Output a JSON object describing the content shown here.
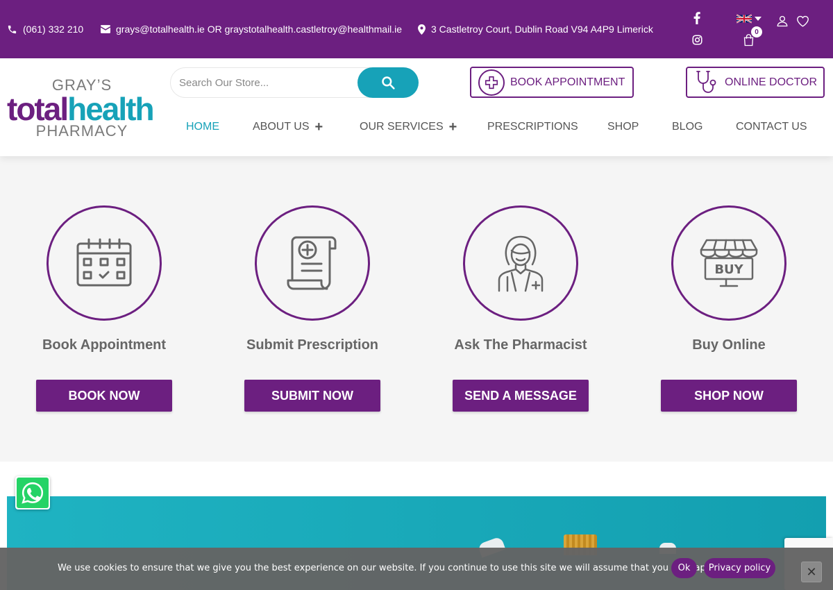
{
  "topbar": {
    "phone": "(061) 332 210",
    "email": "grays@totalhealth.ie OR graystotalhealth.castletroy@healthmail.ie",
    "address": "3 Castletroy Court, Dublin Road V94 A4P9 Limerick",
    "cart_count": "0",
    "icons": [
      "phone-icon",
      "envelope-icon",
      "map-pin-icon",
      "facebook-icon",
      "instagram-icon",
      "uk-flag-icon",
      "user-icon",
      "heart-icon",
      "shopping-bag-icon"
    ]
  },
  "logo": {
    "line1": "GRAY’S",
    "word1": "total",
    "word2": "health",
    "line3": "PHARMACY",
    "colors": {
      "purple": "#6c1f80",
      "teal": "#17a2b8"
    }
  },
  "search": {
    "placeholder": "Search Our Store..."
  },
  "header_buttons": {
    "book": "BOOK APPOINTMENT",
    "doctor": "ONLINE DOCTOR"
  },
  "nav": {
    "home": "HOME",
    "about": "ABOUT US",
    "services": "OUR SERVICES",
    "prescriptions": "PRESCRIPTIONS",
    "shop": "SHOP",
    "blog": "BLOG",
    "contact": "CONTACT US"
  },
  "features": [
    {
      "title": "Book Appointment",
      "button": "BOOK NOW",
      "icon": "calendar-icon"
    },
    {
      "title": "Submit Prescription",
      "button": "SUBMIT NOW",
      "icon": "prescription-scroll-icon"
    },
    {
      "title": "Ask The Pharmacist",
      "button": "SEND A MESSAGE",
      "icon": "pharmacist-icon"
    },
    {
      "title": "Buy Online",
      "button": "SHOP NOW",
      "icon": "shop-buy-icon"
    }
  ],
  "cookie": {
    "text": "We use cookies to ensure that we give you the best experience on our website. If you continue to use this site we will assume that you are happy with it.",
    "ok": "Ok",
    "privacy": "Privacy policy",
    "close": "✕"
  }
}
